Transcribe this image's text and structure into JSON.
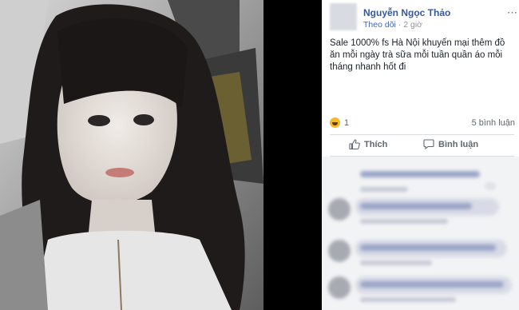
{
  "post": {
    "author": "Nguyễn Ngọc Thảo",
    "follow_label": "Theo dõi",
    "separator": " · ",
    "time": "2 giờ",
    "menu_icon": "⋯",
    "text": "Sale 1000% fs Hà Nội khuyến mại thêm đồ ăn mỗi ngày trà sữa mỗi tuần quần áo mỗi tháng nhanh hốt đi",
    "reaction_icon": "haha-icon",
    "reaction_count": "1",
    "comments_count": "5 bình luận"
  },
  "actions": {
    "like_label": "Thích",
    "comment_label": "Bình luận"
  },
  "colors": {
    "author_link": "#385898",
    "meta": "#90949c",
    "action_text": "#606770",
    "comments_bg": "#f2f3f5"
  }
}
